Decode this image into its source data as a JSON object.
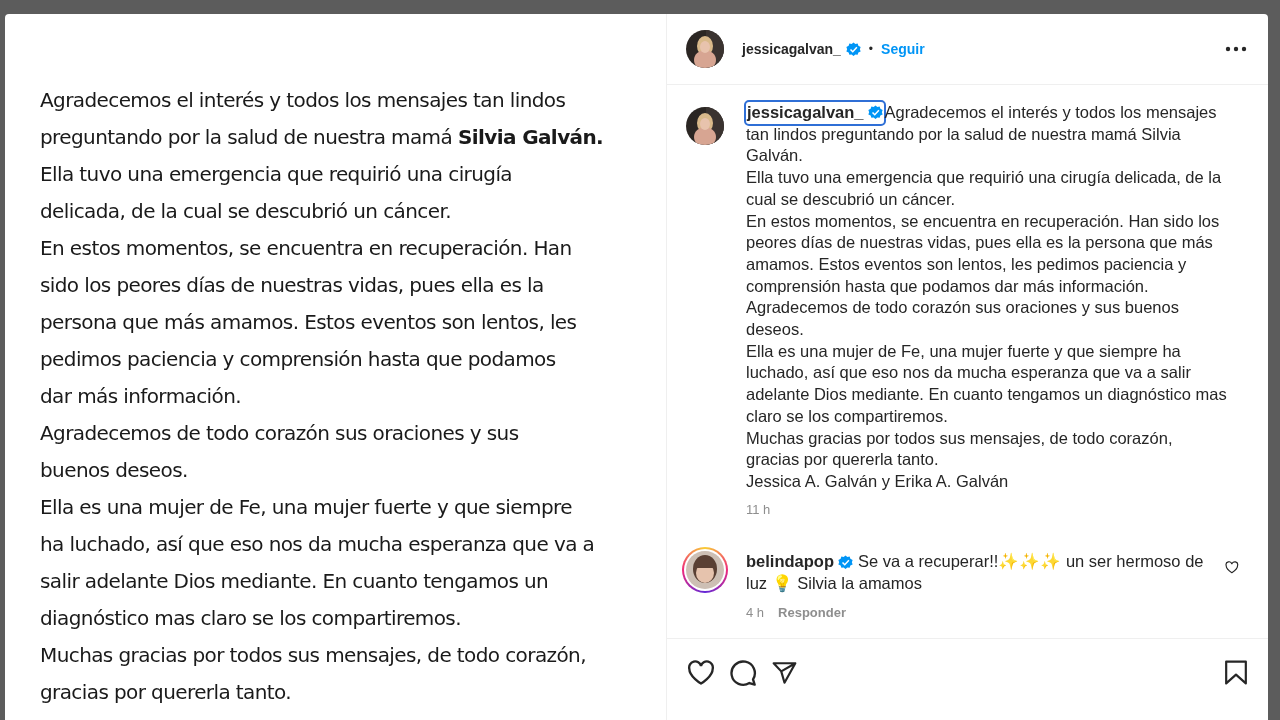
{
  "post_image": {
    "lines": [
      "Agradecemos el interés y todos los mensajes tan lindos",
      "preguntando por la salud de nuestra mamá **Silvia Galván.**",
      "Ella tuvo una emergencia que requirió una cirugía",
      "delicada, de la cual se descubrió un cáncer.",
      "En estos momentos, se encuentra en recuperación. Han",
      "sido los peores días de nuestras vidas, pues ella es la",
      "persona que más amamos. Estos eventos son lentos, les",
      "pedimos paciencia y comprensión hasta que podamos",
      "dar más información.",
      "Agradecemos de todo corazón sus oraciones y sus",
      "buenos deseos.",
      "Ella es una mujer de Fe, una mujer fuerte y que siempre",
      "ha luchado, así que eso nos da mucha esperanza que va a",
      "salir adelante Dios mediante. En cuanto tengamos un",
      "diagnóstico mas claro se los compartiremos.",
      "Muchas gracias por todos sus mensajes, de todo corazón,",
      "gracias por quererla tanto."
    ]
  },
  "header": {
    "username": "jessicagalvan_",
    "verified": true,
    "separator": "•",
    "follow": "Seguir"
  },
  "caption": {
    "username": "jessicagalvan_",
    "verified": true,
    "focused": true,
    "paragraphs": [
      "Agradecemos el interés y todos los mensajes tan lindos preguntando por la salud de nuestra mamá Silvia Galván.",
      "Ella tuvo una emergencia que requirió una cirugía delicada, de la cual se descubrió un cáncer.",
      "En estos momentos, se encuentra en recuperación. Han sido los peores días de nuestras vidas, pues ella es la persona que más amamos. Estos eventos son lentos, les pedimos paciencia y comprensión hasta que podamos dar más información.",
      "Agradecemos de todo corazón sus oraciones y sus buenos deseos.",
      "Ella es una mujer de Fe, una mujer fuerte y que siempre ha luchado, así que eso nos da mucha esperanza que va a salir adelante Dios mediante. En cuanto tengamos un diagnóstico mas claro se los compartiremos.",
      "Muchas gracias por todos sus mensajes, de todo corazón, gracias por quererla tanto.",
      "Jessica A. Galván y Erika A. Galván"
    ],
    "time": "11 h"
  },
  "comments": [
    {
      "username": "belindapop",
      "verified": true,
      "story_ring": true,
      "text": "Se va a recuperar!!✨✨✨ un ser hermoso de luz 💡 Silvia la amamos",
      "time": "4 h",
      "reply": "Responder",
      "liked": false
    }
  ]
}
